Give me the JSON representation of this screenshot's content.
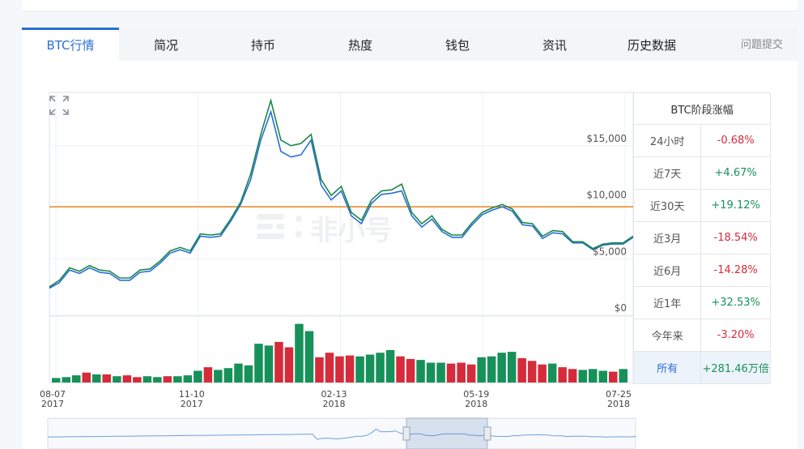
{
  "tabs": [
    {
      "label": "BTC行情",
      "active": true
    },
    {
      "label": "简况"
    },
    {
      "label": "持币"
    },
    {
      "label": "热度"
    },
    {
      "label": "钱包"
    },
    {
      "label": "资讯"
    },
    {
      "label": "历史数据"
    }
  ],
  "feedback_label": "问题提交",
  "watermark": "非小号",
  "stats": {
    "title": "BTC阶段涨幅",
    "rows": [
      {
        "label": "24小时",
        "value": "-0.68%",
        "trend": "down"
      },
      {
        "label": "近7天",
        "value": "+4.67%",
        "trend": "up"
      },
      {
        "label": "近30天",
        "value": "+19.12%",
        "trend": "up"
      },
      {
        "label": "近3月",
        "value": "-18.54%",
        "trend": "down"
      },
      {
        "label": "近6月",
        "value": "-14.28%",
        "trend": "down"
      },
      {
        "label": "近1年",
        "value": "+32.53%",
        "trend": "up"
      },
      {
        "label": "今年来",
        "value": "-3.20%",
        "trend": "down"
      },
      {
        "label": "所有",
        "value": "+281.46万倍",
        "trend": "up"
      }
    ]
  },
  "colors": {
    "accent": "#2a6fd6",
    "up": "#17915a",
    "down": "#d62b3a",
    "price_line": "#2a6fd6",
    "price_line_secondary": "#19884a",
    "reference_line": "#e8821e"
  },
  "chart_data": {
    "type": "line",
    "x_ticks": [
      {
        "date": "08-07",
        "year": "2017"
      },
      {
        "date": "11-10",
        "year": "2017"
      },
      {
        "date": "02-13",
        "year": "2018"
      },
      {
        "date": "05-19",
        "year": "2018"
      },
      {
        "date": "07-25",
        "year": "2018"
      }
    ],
    "y_ticks": [
      "$0",
      "$5,000",
      "$10,000",
      "$15,000"
    ],
    "ylim": [
      0,
      19000
    ],
    "reference_value": 9600,
    "grid": true,
    "series": [
      {
        "values": [
          2400,
          2900,
          4000,
          3700,
          4200,
          3800,
          3700,
          3100,
          3100,
          3800,
          3900,
          4600,
          5500,
          5800,
          5500,
          7000,
          6900,
          7000,
          8300,
          9800,
          12000,
          15500,
          18000,
          14500,
          14000,
          14200,
          15500,
          11500,
          10200,
          11000,
          8800,
          8100,
          9900,
          10700,
          10800,
          11000,
          8800,
          7800,
          8500,
          7400,
          6900,
          6900,
          8000,
          8900,
          9300,
          9600,
          9200,
          8000,
          7900,
          6800,
          7300,
          7200,
          6400,
          6400,
          5800,
          6200,
          6300,
          6300,
          6900
        ]
      },
      {
        "values": [
          2500,
          3100,
          4200,
          3900,
          4400,
          4000,
          3900,
          3300,
          3300,
          4000,
          4100,
          4800,
          5700,
          6000,
          5700,
          7200,
          7100,
          7200,
          8500,
          10000,
          12500,
          16000,
          19000,
          15500,
          15000,
          15200,
          16000,
          12000,
          10600,
          11400,
          9100,
          8400,
          10200,
          11000,
          11100,
          11600,
          9100,
          8100,
          8800,
          7600,
          7100,
          7100,
          8200,
          9100,
          9500,
          9800,
          9400,
          8200,
          8100,
          7000,
          7500,
          7400,
          6500,
          6500,
          5900,
          6300,
          6400,
          6400,
          7000
        ]
      }
    ],
    "volume": {
      "values": [
        5,
        6,
        8,
        11,
        9,
        9,
        7,
        8,
        6,
        7,
        6,
        7,
        7,
        8,
        13,
        17,
        14,
        16,
        21,
        19,
        43,
        41,
        45,
        39,
        65,
        57,
        28,
        33,
        29,
        30,
        29,
        31,
        33,
        36,
        29,
        26,
        25,
        22,
        22,
        21,
        22,
        20,
        28,
        29,
        33,
        34,
        27,
        24,
        20,
        21,
        17,
        15,
        14,
        15,
        13,
        12,
        15
      ],
      "directions": [
        "up",
        "up",
        "up",
        "down",
        "up",
        "down",
        "up",
        "down",
        "down",
        "up",
        "up",
        "down",
        "up",
        "up",
        "up",
        "down",
        "up",
        "up",
        "up",
        "up",
        "up",
        "up",
        "down",
        "down",
        "up",
        "up",
        "down",
        "down",
        "down",
        "down",
        "up",
        "up",
        "up",
        "up",
        "down",
        "down",
        "up",
        "up",
        "up",
        "down",
        "down",
        "down",
        "up",
        "up",
        "up",
        "up",
        "down",
        "down",
        "down",
        "up",
        "down",
        "down",
        "up",
        "up",
        "up",
        "down",
        "up"
      ],
      "ylim": [
        0,
        70
      ]
    }
  }
}
